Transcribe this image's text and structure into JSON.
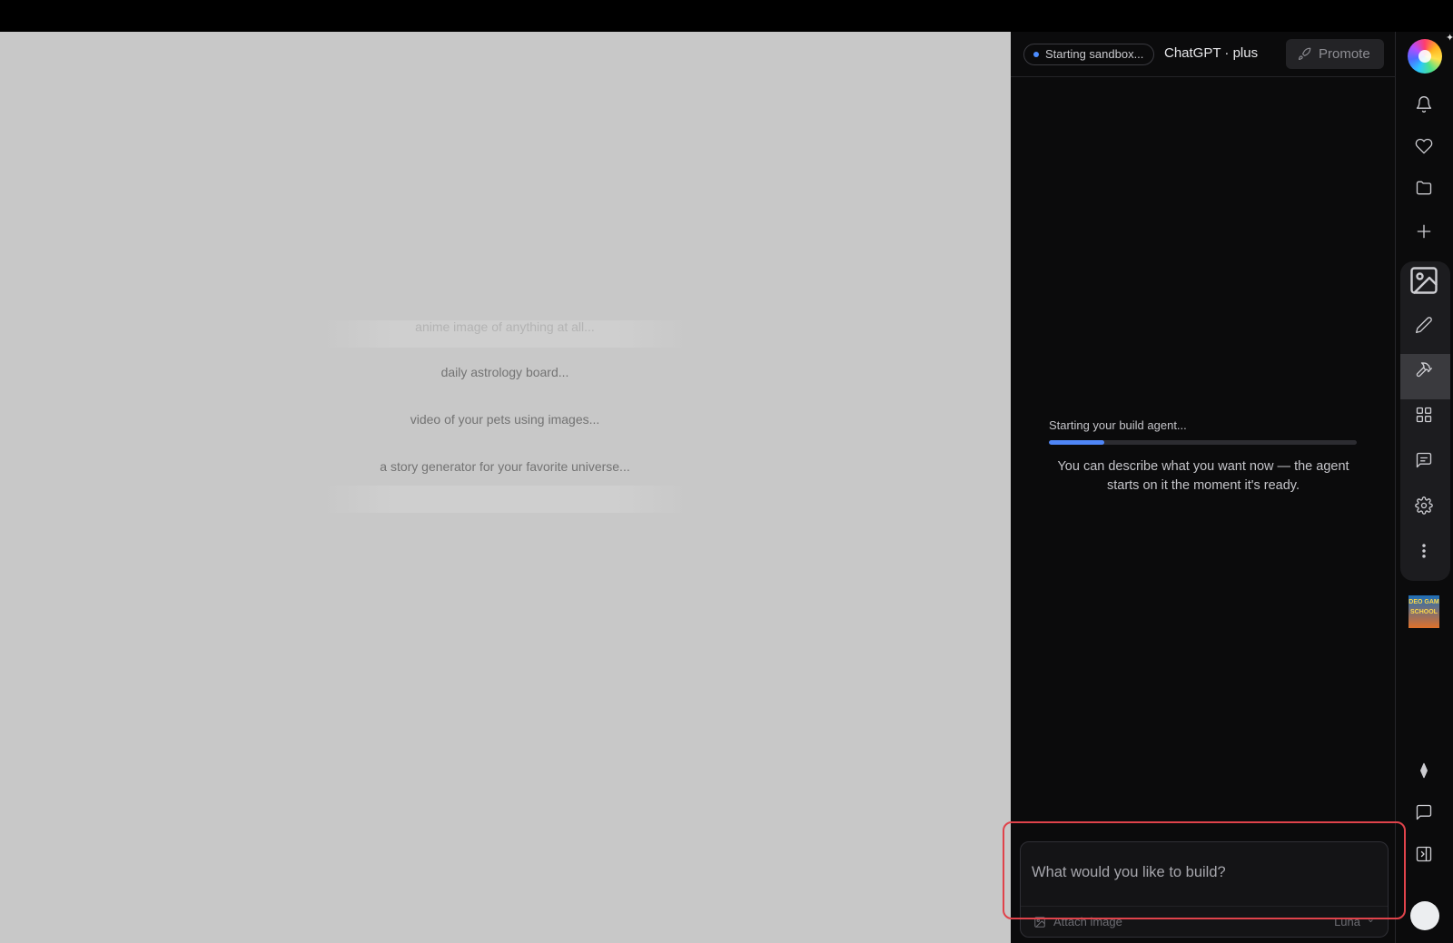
{
  "preview": {
    "suggestions": [
      {
        "text": "anime image of anything at all...",
        "faded": true
      },
      {
        "text": "daily astrology board...",
        "faded": false
      },
      {
        "text": "video of your pets using images...",
        "faded": false
      },
      {
        "text": "a story generator for your favorite universe...",
        "faded": false
      },
      {
        "text": "",
        "faded": true
      }
    ]
  },
  "header": {
    "status": "Starting sandbox...",
    "plan": "ChatGPT · plus",
    "promote_label": "Promote"
  },
  "build": {
    "title": "Starting your build agent...",
    "progress": 0.18,
    "hint": "You can describe what you want now — the agent starts on it the moment it's ready."
  },
  "composer": {
    "placeholder": "What would you like to build?",
    "attach_label": "Attach image",
    "model": "Luna"
  },
  "rail": {
    "icons": [
      "bell-icon",
      "heart-icon",
      "folder-icon",
      "plus-icon",
      "image-icon",
      "pencil-icon",
      "hammer-icon",
      "grid-icon",
      "message-icon",
      "settings-icon",
      "more-icon",
      "diamond-icon",
      "chat-icon",
      "panel-icon"
    ],
    "thumb_label": "DEO GAM SCHOOL"
  },
  "colors": {
    "accent": "#4f86f7",
    "highlight": "#e0434b",
    "panel_bg": "#0b0b0c",
    "preview_bg": "#c8c8c8"
  }
}
